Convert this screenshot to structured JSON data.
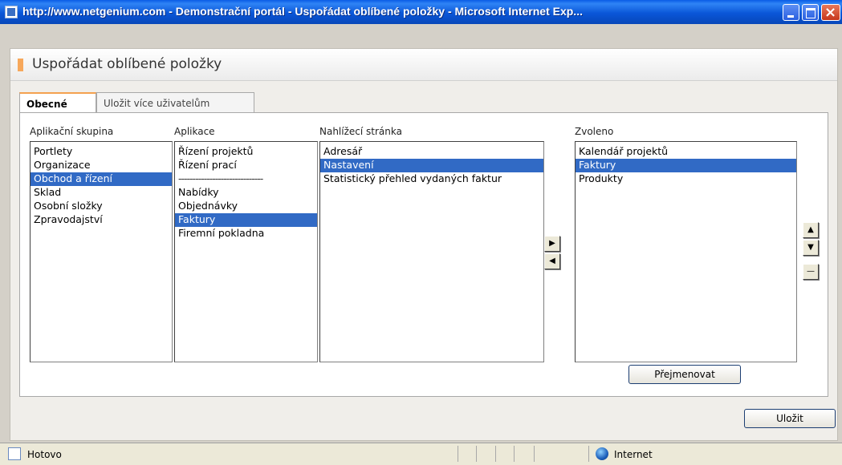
{
  "window": {
    "title": "http://www.netgenium.com - Demonstrační portál - Uspořádat oblíbené položky - Microsoft Internet Exp..."
  },
  "page": {
    "title": "Uspořádat oblíbené položky",
    "accent_color": "#f7a85b"
  },
  "tabs": [
    {
      "label": "Obecné",
      "active": true
    },
    {
      "label": "Uložit více uživatelům",
      "active": false
    }
  ],
  "lists": {
    "group": {
      "label": "Aplikační skupina",
      "items": [
        "Portlety",
        "Organizace",
        "Obchod a řízení",
        "Sklad",
        "Osobní složky",
        "Zpravodajství"
      ],
      "selected": "Obchod a řízení"
    },
    "app": {
      "label": "Aplikace",
      "items": [
        "Řízení projektů",
        "Řízení prací",
        "------------------------------",
        "Nabídky",
        "Objednávky",
        "Faktury",
        "Firemní pokladna"
      ],
      "selected": "Faktury"
    },
    "view": {
      "label": "Nahlížecí stránka",
      "items": [
        "Adresář",
        "Nastavení",
        "Statistický přehled vydaných faktur"
      ],
      "selected": "Nastavení"
    },
    "chosen": {
      "label": "Zvoleno",
      "items": [
        "Kalendář projektů",
        "Faktury",
        "Produkty"
      ],
      "selected": "Faktury"
    }
  },
  "buttons": {
    "add": "▶",
    "remove": "◀",
    "up": "▲",
    "down": "▼",
    "delete": "—",
    "rename": "Přejmenovat",
    "save": "Uložit"
  },
  "icons": {
    "add": "arrow-right-icon",
    "remove": "arrow-left-icon",
    "up": "arrow-up-icon",
    "down": "arrow-down-icon",
    "delete": "minus-icon"
  },
  "statusbar": {
    "status": "Hotovo",
    "zone": "Internet"
  },
  "colors": {
    "selection": "#316ac5",
    "titlebar": "#0a56d8"
  }
}
